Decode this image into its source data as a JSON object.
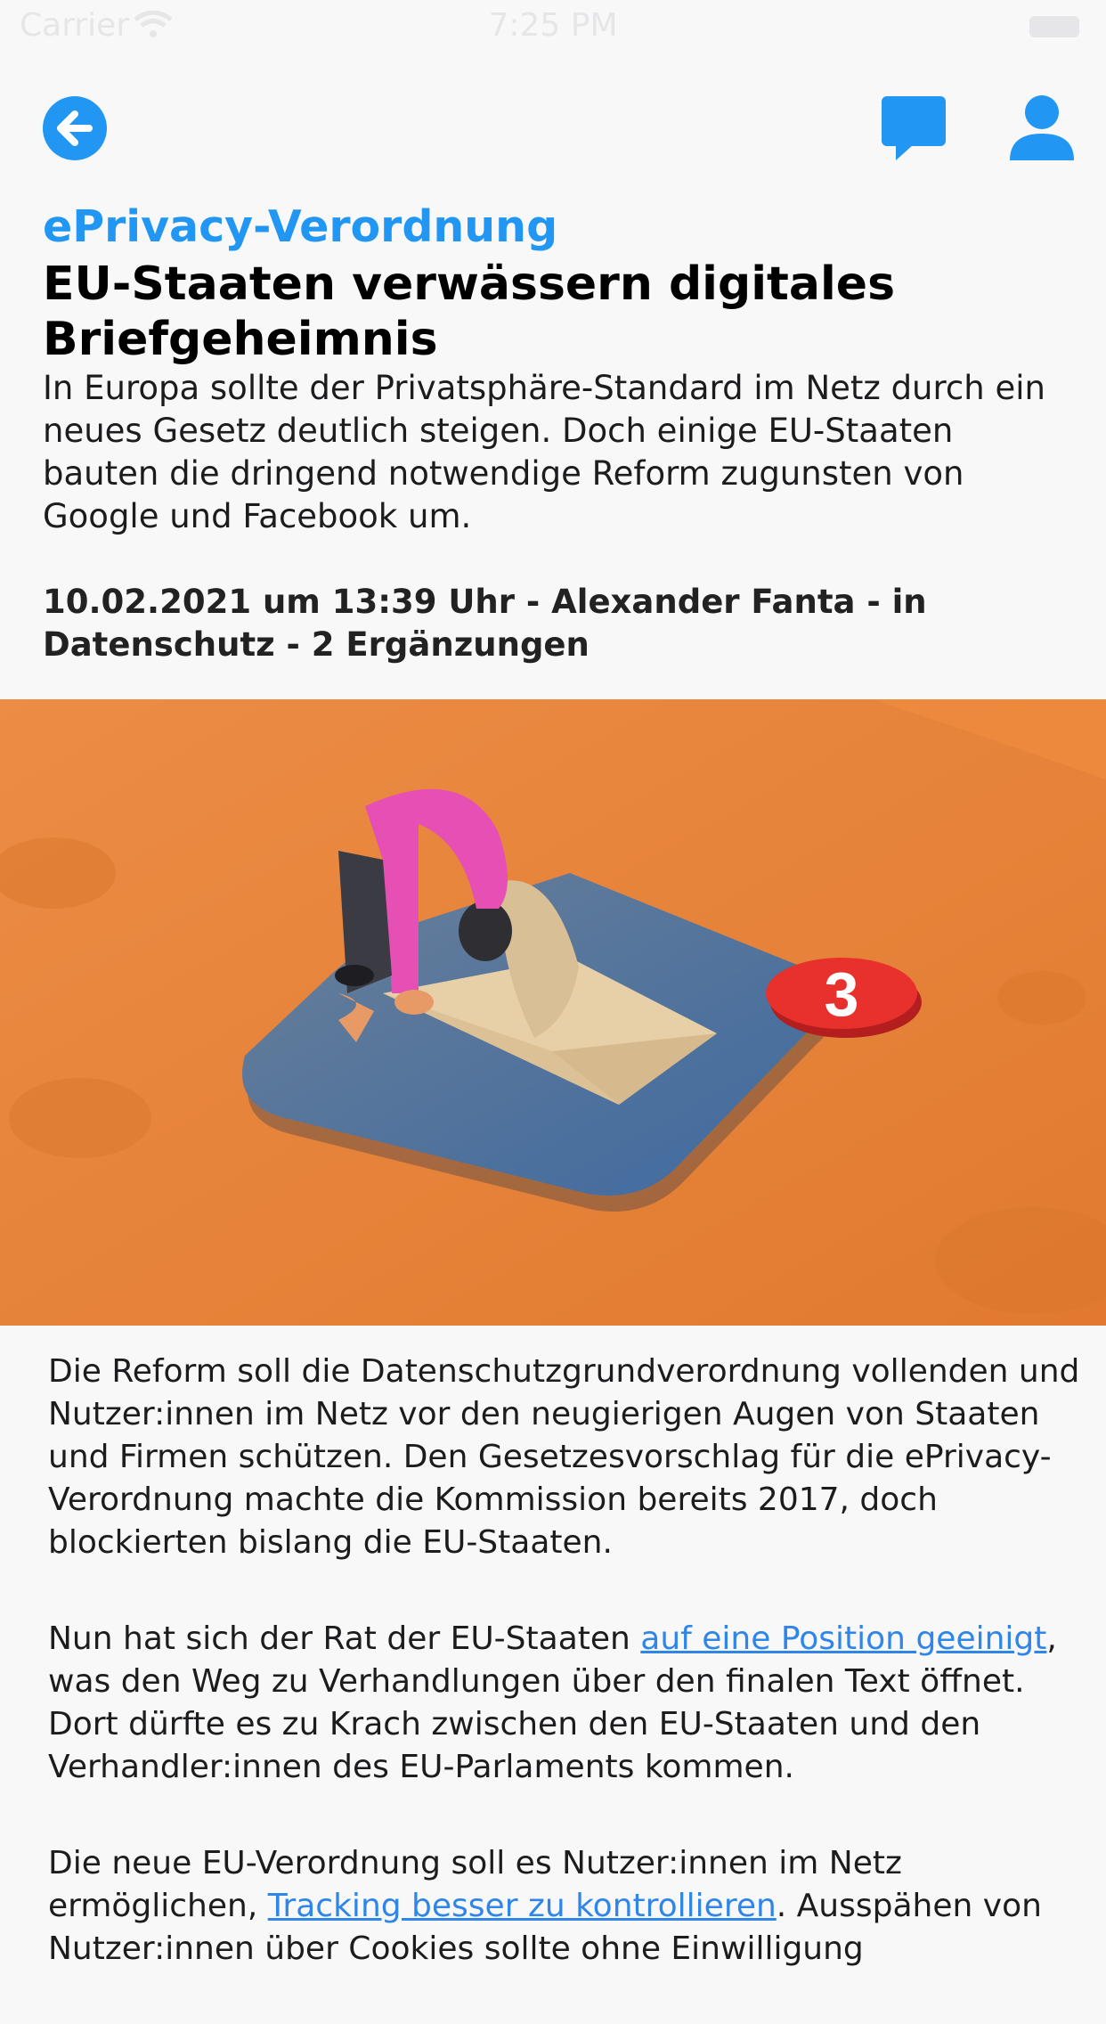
{
  "status_bar": {
    "carrier": "Carrier",
    "time": "7:25 PM"
  },
  "icons": {
    "back": "arrow-left-circle-icon",
    "comments": "speech-bubble-icon",
    "profile": "person-icon"
  },
  "colors": {
    "accent": "#2196f3",
    "link": "#2f86e8",
    "hero_background": "#e8833a",
    "pad": "#4a6d93",
    "badge": "#e8302c"
  },
  "article": {
    "kicker": "ePrivacy-Verordnung",
    "title": "EU-Staaten verwässern digitales Briefgeheimnis",
    "teaser": "In Europa sollte der Privatsphäre-Standard im Netz durch ein neues Gesetz deutlich steigen. Doch einige EU-Staaten bauten die dringend notwendige Reform zugunsten von Google und Facebook um.",
    "meta": "10.02.2021 um 13:39 Uhr - Alexander Fanta - in Datenschutz - 2 Ergänzungen",
    "hero_badge": "3",
    "paragraph1": "Die Reform soll die Datenschutzgrundverordnung vollenden und Nutzer:innen im Netz vor den neugierigen Augen von Staaten und Firmen schützen. Den Gesetzesvorschlag für die ePrivacy-Verordnung machte die Kommission bereits 2017, doch blockierten bislang die EU-Staaten.",
    "paragraph2": {
      "before": "Nun hat sich der Rat der EU-Staaten ",
      "link": "auf eine Position geeinigt",
      "after": ", was den Weg zu Verhandlungen über den finalen Text öffnet. Dort dürfte es zu Krach zwischen den EU-Staaten und den Verhandler:innen des EU-Parlaments kommen."
    },
    "paragraph3": {
      "before": "Die neue EU-Verordnung soll es Nutzer:innen im Netz ermöglichen, ",
      "link": "Tracking besser zu kontrollieren",
      "after": ". Ausspähen von Nutzer:innen über Cookies sollte ohne Einwilligung"
    }
  }
}
